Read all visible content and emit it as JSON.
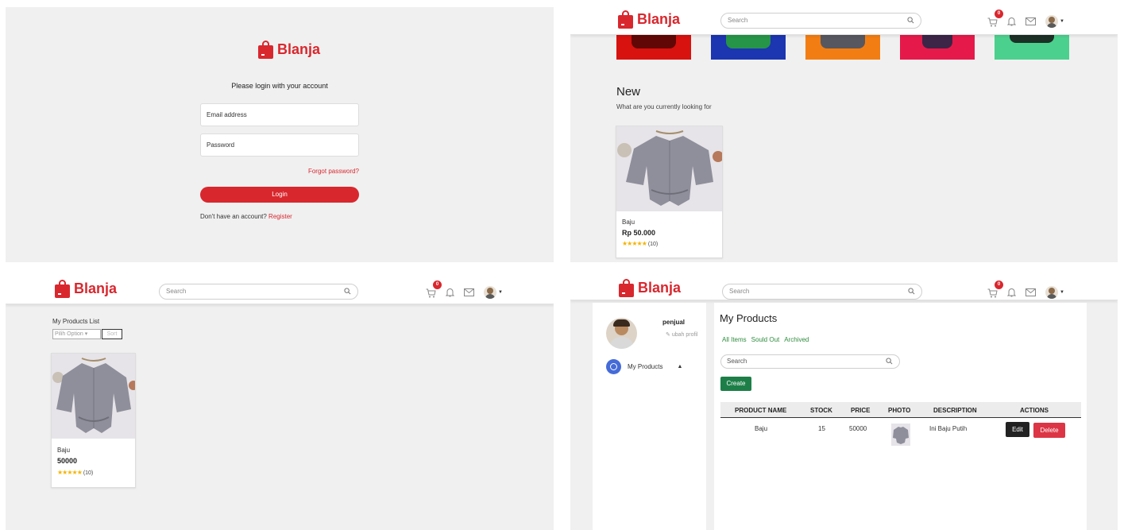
{
  "brand": "Blanja",
  "login": {
    "title": "Please login with your account",
    "email_placeholder": "Email address",
    "password_placeholder": "Password",
    "forgot": "Forgot password?",
    "login_button": "Login",
    "register_prompt": "Don't have an account?",
    "register_link": "Register"
  },
  "header": {
    "search_placeholder": "Search",
    "cart_count": "0"
  },
  "home": {
    "section_title": "New",
    "section_subtitle": "What are you currently looking for",
    "product": {
      "name": "Baju",
      "price": "Rp 50.000",
      "rating_count": "(10)"
    },
    "category_colors": [
      "#d7120f",
      "#1c35b0",
      "#f27e13",
      "#e51a4b",
      "#4cd08e"
    ]
  },
  "my_products_list": {
    "title": "My Products List",
    "select_value": "Pilih Option",
    "sort_label": "Sort",
    "product": {
      "name": "Baju",
      "price": "50000",
      "rating_count": "(10)"
    }
  },
  "seller": {
    "username": "penjual",
    "edit_profile": "ubah profil",
    "menu_item": "My Products",
    "page_title": "My Products",
    "tabs": [
      "All Items",
      "Sould Out",
      "Archived"
    ],
    "search_placeholder": "Search",
    "create_button": "Create",
    "table": {
      "headers": [
        "PRODUCT NAME",
        "STOCK",
        "PRICE",
        "PHOTO",
        "DESCRIPTION",
        "ACTIONS"
      ],
      "rows": [
        {
          "name": "Baju",
          "stock": "15",
          "price": "50000",
          "description": "Ini Baju Putih"
        }
      ],
      "edit_label": "Edit",
      "delete_label": "Delete"
    }
  },
  "colors": {
    "brand_red": "#d9272e",
    "green": "#1d7f47",
    "danger": "#dc3545"
  }
}
